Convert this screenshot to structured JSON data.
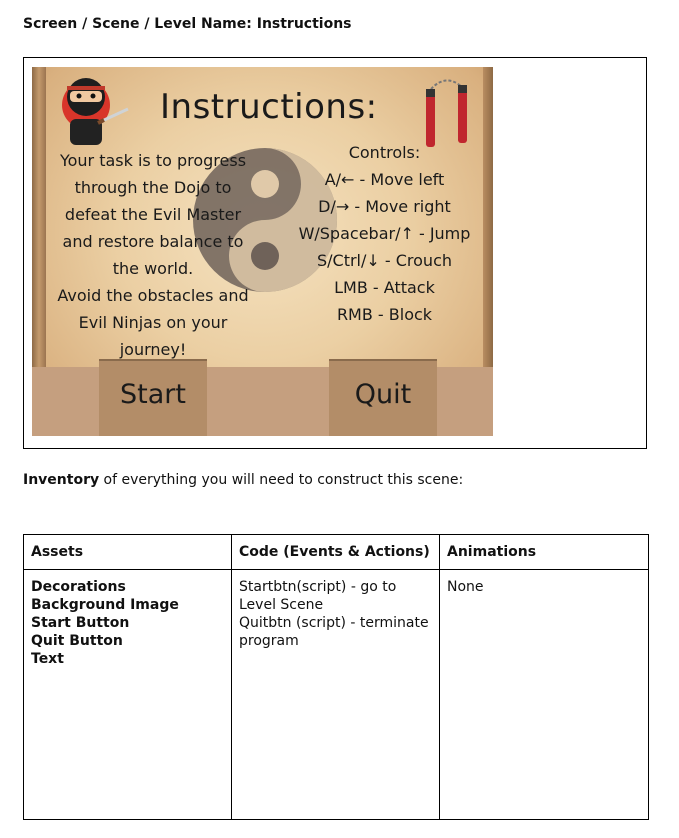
{
  "heading": "Screen / Scene / Level Name: Instructions",
  "game_screen": {
    "title": "Instructions:",
    "task_lines": [
      "Your task is to progress",
      "through the Dojo to",
      "defeat the Evil Master",
      "and restore balance to",
      "the world.",
      "Avoid the obstacles and",
      "Evil Ninjas on your",
      "journey!"
    ],
    "controls_title": "Controls:",
    "controls": [
      "A/← - Move left",
      "D/→ - Move right",
      "W/Spacebar/↑ - Jump",
      "S/Ctrl/↓ - Crouch",
      "LMB - Attack",
      "RMB - Block"
    ],
    "start_label": "Start",
    "quit_label": "Quit"
  },
  "inventory": {
    "bold": "Inventory",
    "rest": " of everything you will need to construct this scene:"
  },
  "table": {
    "headers": [
      "Assets",
      "Code (Events & Actions)",
      "Animations"
    ],
    "assets": [
      "Decorations",
      "Background Image",
      "Start Button",
      "Quit Button",
      "Text"
    ],
    "code": [
      "Startbtn(script) - go to Level Scene",
      "Quitbtn (script) - terminate program"
    ],
    "animations": "None"
  }
}
